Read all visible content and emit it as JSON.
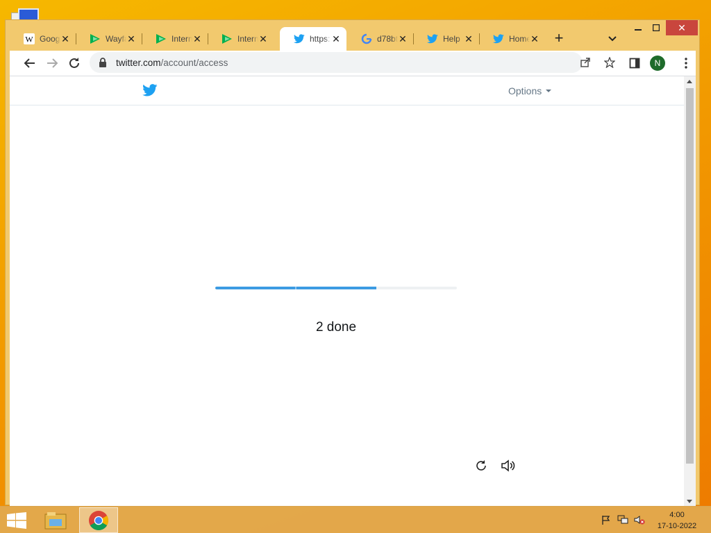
{
  "browser": {
    "tabs": [
      {
        "title": "Googl",
        "favicon": "wikipedia-icon",
        "active": false
      },
      {
        "title": "Wayfa",
        "favicon": "wayfair-icon",
        "active": false
      },
      {
        "title": "Intern",
        "favicon": "internshala-icon",
        "active": false
      },
      {
        "title": "Intern",
        "favicon": "internshala-icon",
        "active": false
      },
      {
        "title": "https:",
        "favicon": "twitter-icon",
        "active": true
      },
      {
        "title": "d78bt",
        "favicon": "google-icon",
        "active": false
      },
      {
        "title": "Help",
        "favicon": "twitter-icon",
        "active": false
      },
      {
        "title": "Home",
        "favicon": "twitter-icon",
        "active": false
      }
    ],
    "address": {
      "domain": "twitter.com",
      "path": "/account/access"
    },
    "profile_initial": "N"
  },
  "page": {
    "options_label": "Options",
    "progress_fraction": 0.667,
    "status_text": "2 done"
  },
  "taskbar": {
    "time": "4:00",
    "date": "17-10-2022"
  },
  "colors": {
    "twitter_blue": "#1da1f2",
    "progress_blue": "#3c9be2",
    "internshala_green": "#00b04f"
  }
}
